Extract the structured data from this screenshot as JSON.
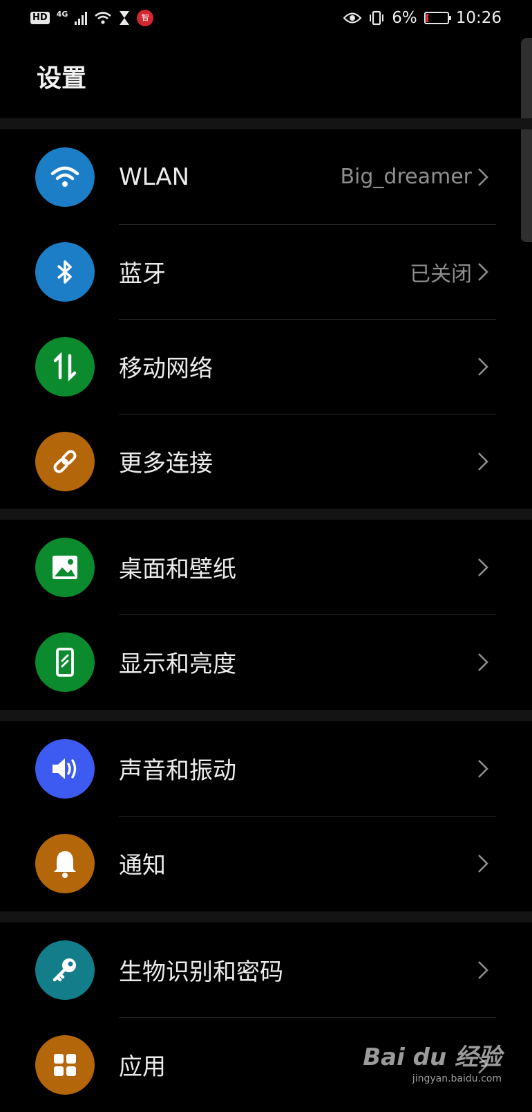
{
  "status_bar": {
    "hd": "HD",
    "network": "4G",
    "notif_badge": "智",
    "battery": "6%",
    "time": "10:26"
  },
  "page": {
    "title": "设置"
  },
  "settings": [
    {
      "label": "WLAN",
      "value": "Big_dreamer",
      "icon": "wifi-icon",
      "color": "#1b7ec6"
    },
    {
      "label": "蓝牙",
      "value": "已关闭",
      "icon": "bluetooth-icon",
      "color": "#1b7ec6"
    },
    {
      "label": "移动网络",
      "value": "",
      "icon": "mobile-data-icon",
      "color": "#0b8a2e"
    },
    {
      "label": "更多连接",
      "value": "",
      "icon": "link-icon",
      "color": "#b4660b"
    },
    {
      "label": "桌面和壁纸",
      "value": "",
      "icon": "wallpaper-icon",
      "color": "#0b8a2e"
    },
    {
      "label": "显示和亮度",
      "value": "",
      "icon": "display-icon",
      "color": "#0b8a2e"
    },
    {
      "label": "声音和振动",
      "value": "",
      "icon": "sound-icon",
      "color": "#3d5bf0"
    },
    {
      "label": "通知",
      "value": "",
      "icon": "bell-icon",
      "color": "#b4660b"
    },
    {
      "label": "生物识别和密码",
      "value": "",
      "icon": "key-icon",
      "color": "#137d8a"
    },
    {
      "label": "应用",
      "value": "",
      "icon": "apps-icon",
      "color": "#b4660b"
    }
  ],
  "watermark": {
    "brand": "Bai du 经验",
    "url": "jingyan.baidu.com"
  }
}
